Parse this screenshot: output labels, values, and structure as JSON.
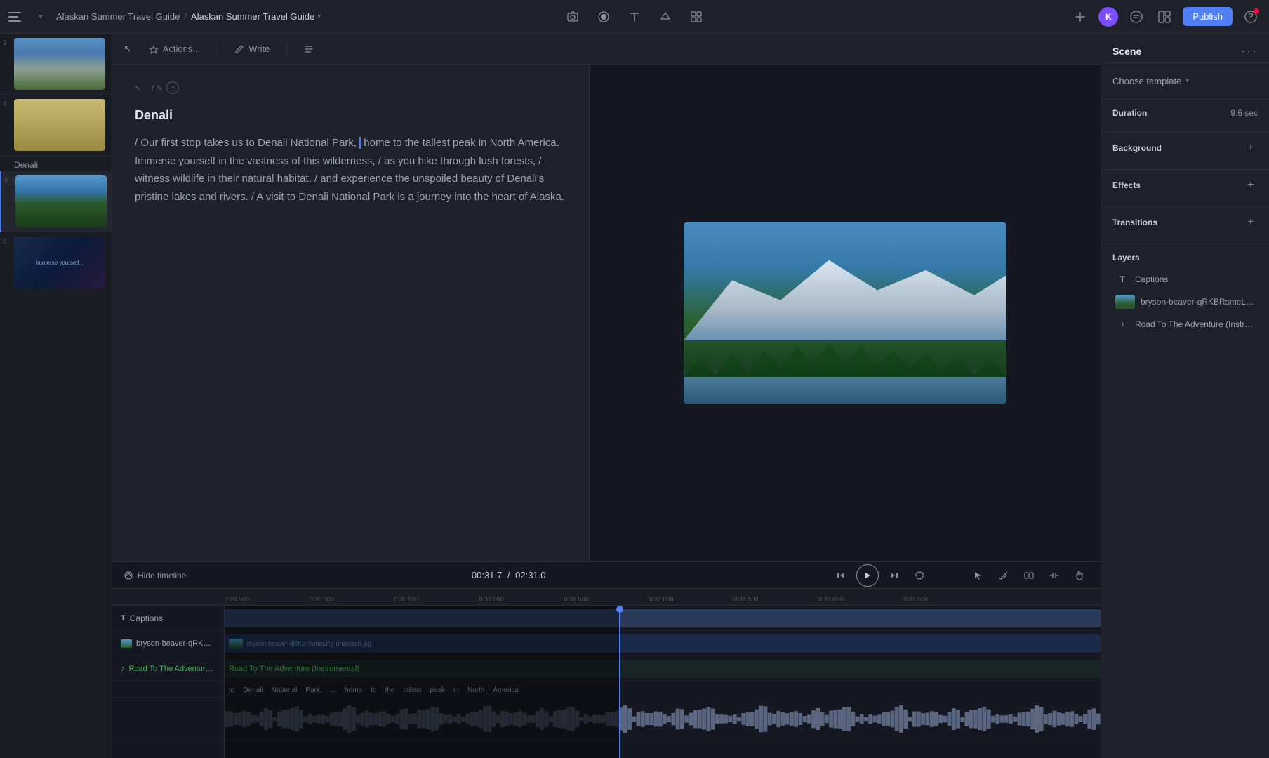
{
  "topbar": {
    "project_name": "Alaskan Summer Travel Guide",
    "breadcrumb_sep": "/",
    "scene_name": "Alaskan Summer Travel Guide",
    "publish_label": "Publish",
    "avatar_initials": "K",
    "chevron": "▾"
  },
  "toolbar": {
    "actions_label": "Actions...",
    "write_label": "Write"
  },
  "slides": [
    {
      "number": "3",
      "type": "snow"
    },
    {
      "number": "4",
      "type": "map"
    },
    {
      "label": "Denali",
      "number": "",
      "type": "label"
    },
    {
      "number": "5",
      "type": "forest"
    },
    {
      "number": "6",
      "type": "text_card"
    }
  ],
  "editor": {
    "scene_title": "Denali",
    "script_text": "/ Our first stop takes us to Denali National Park, home to the tallest peak in North America. Immerse yourself in the vastness of this wilderness, / as you hike through lush forests, / witness wildlife in their natural habitat, / and experience the unspoiled beauty of Denali's pristine lakes and rivers. / A visit to Denali National Park is a journey into the heart of Alaska."
  },
  "timeline": {
    "hide_label": "Hide timeline",
    "current_time": "00:31.7",
    "total_time": "02:31.0",
    "separator": "/",
    "ruler_marks": [
      "0:29.500",
      "0:30.000",
      "0:30.500",
      "0:31.000",
      "0:31.500",
      "0:32.000",
      "0:32.500",
      "0:33.000",
      "0:33.500"
    ],
    "tracks": {
      "captions_label": "Captions",
      "image_label": "bryson-beaver-qRKBRsmeLPg-unsplash.jpg",
      "music_label": "Road To The Adventure (Instrumental)"
    },
    "words": [
      "to",
      "Denali",
      "National",
      "Park,",
      "...",
      "home",
      "to",
      "the",
      "tallest",
      "peak",
      "in",
      "North",
      "America"
    ]
  },
  "right_panel": {
    "scene_title": "Scene",
    "dots_menu": "···",
    "choose_template_label": "Choose template",
    "duration_label": "Duration",
    "duration_value": "9.6 sec",
    "background_label": "Background",
    "effects_label": "Effects",
    "transitions_label": "Transitions",
    "layers_label": "Layers",
    "layers": [
      {
        "type": "text",
        "label": "Captions",
        "icon": "T"
      },
      {
        "type": "image",
        "label": "bryson-beaver-qRKBRsmeLPg-...",
        "icon": "img"
      },
      {
        "type": "music",
        "label": "Road To The Adventure (Instru...",
        "icon": "♪"
      }
    ]
  }
}
